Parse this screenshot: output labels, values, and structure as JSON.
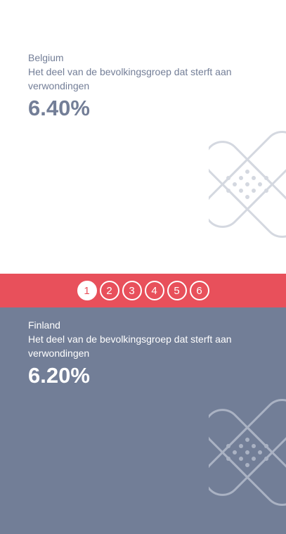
{
  "menu": {
    "icon": "hamburger-icon"
  },
  "slides": [
    {
      "country": "Belgium",
      "description": "Het deel van de bevolkingsgroep dat sterft aan verwondingen",
      "value": "6.40%"
    },
    {
      "country": "Finland",
      "description": "Het deel van de bevolkingsgroep dat sterft aan verwondingen",
      "value": "6.20%"
    }
  ],
  "pagination": {
    "pages": [
      "1",
      "2",
      "3",
      "4",
      "5",
      "6"
    ],
    "active": "1"
  },
  "colors": {
    "accent": "#e8505b",
    "slate": "#727e97",
    "text_dark": "#737e97",
    "white": "#ffffff"
  },
  "icons": {
    "decoration": "bandage-icon"
  }
}
